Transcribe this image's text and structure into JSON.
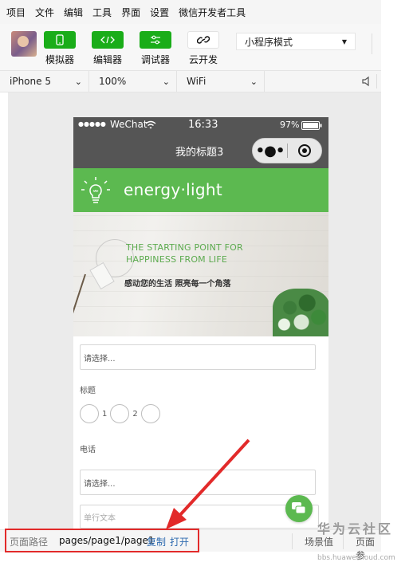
{
  "menu": [
    "项目",
    "文件",
    "编辑",
    "工具",
    "界面",
    "设置",
    "微信开发者工具"
  ],
  "toolbar": {
    "tools": [
      {
        "label": "模拟器",
        "icon": "phone-icon"
      },
      {
        "label": "编辑器",
        "icon": "code-icon"
      },
      {
        "label": "调试器",
        "icon": "debug-icon"
      },
      {
        "label": "云开发",
        "icon": "cloud-link-icon"
      }
    ],
    "mode": "小程序模式"
  },
  "devicebar": {
    "device": "iPhone 5",
    "zoom": "100%",
    "network": "WiFi"
  },
  "phone": {
    "signal": "●●●●●",
    "carrier": "WeChat",
    "time": "16:33",
    "battery": "97%",
    "nav_title": "我的标题3",
    "brand": "energy·light",
    "banner": {
      "tagline_1": "THE STARTING POINT FOR",
      "tagline_2": "HAPPINESS FROM LIFE",
      "subtitle": "感动您的生活 照亮每一个角落"
    },
    "form": {
      "select_1_placeholder": "请选择...",
      "title_label": "标题",
      "radio_labels": [
        "1",
        "2"
      ],
      "phone_label": "电话",
      "select_2_placeholder": "请选择...",
      "text_placeholder": "单行文本"
    }
  },
  "bottombar": {
    "path_label": "页面路径",
    "path": "pages/page1/page1",
    "copy": "复制",
    "open": "打开",
    "scene": "场景值",
    "page_params": "页面参"
  },
  "watermark": {
    "text": "华为云社区",
    "url": "bbs.huaweicloud.com"
  },
  "colors": {
    "wechat_green": "#1aad19",
    "brand_green": "#5cb950",
    "highlight_red": "#e22a2a",
    "phone_nav": "#555555"
  }
}
